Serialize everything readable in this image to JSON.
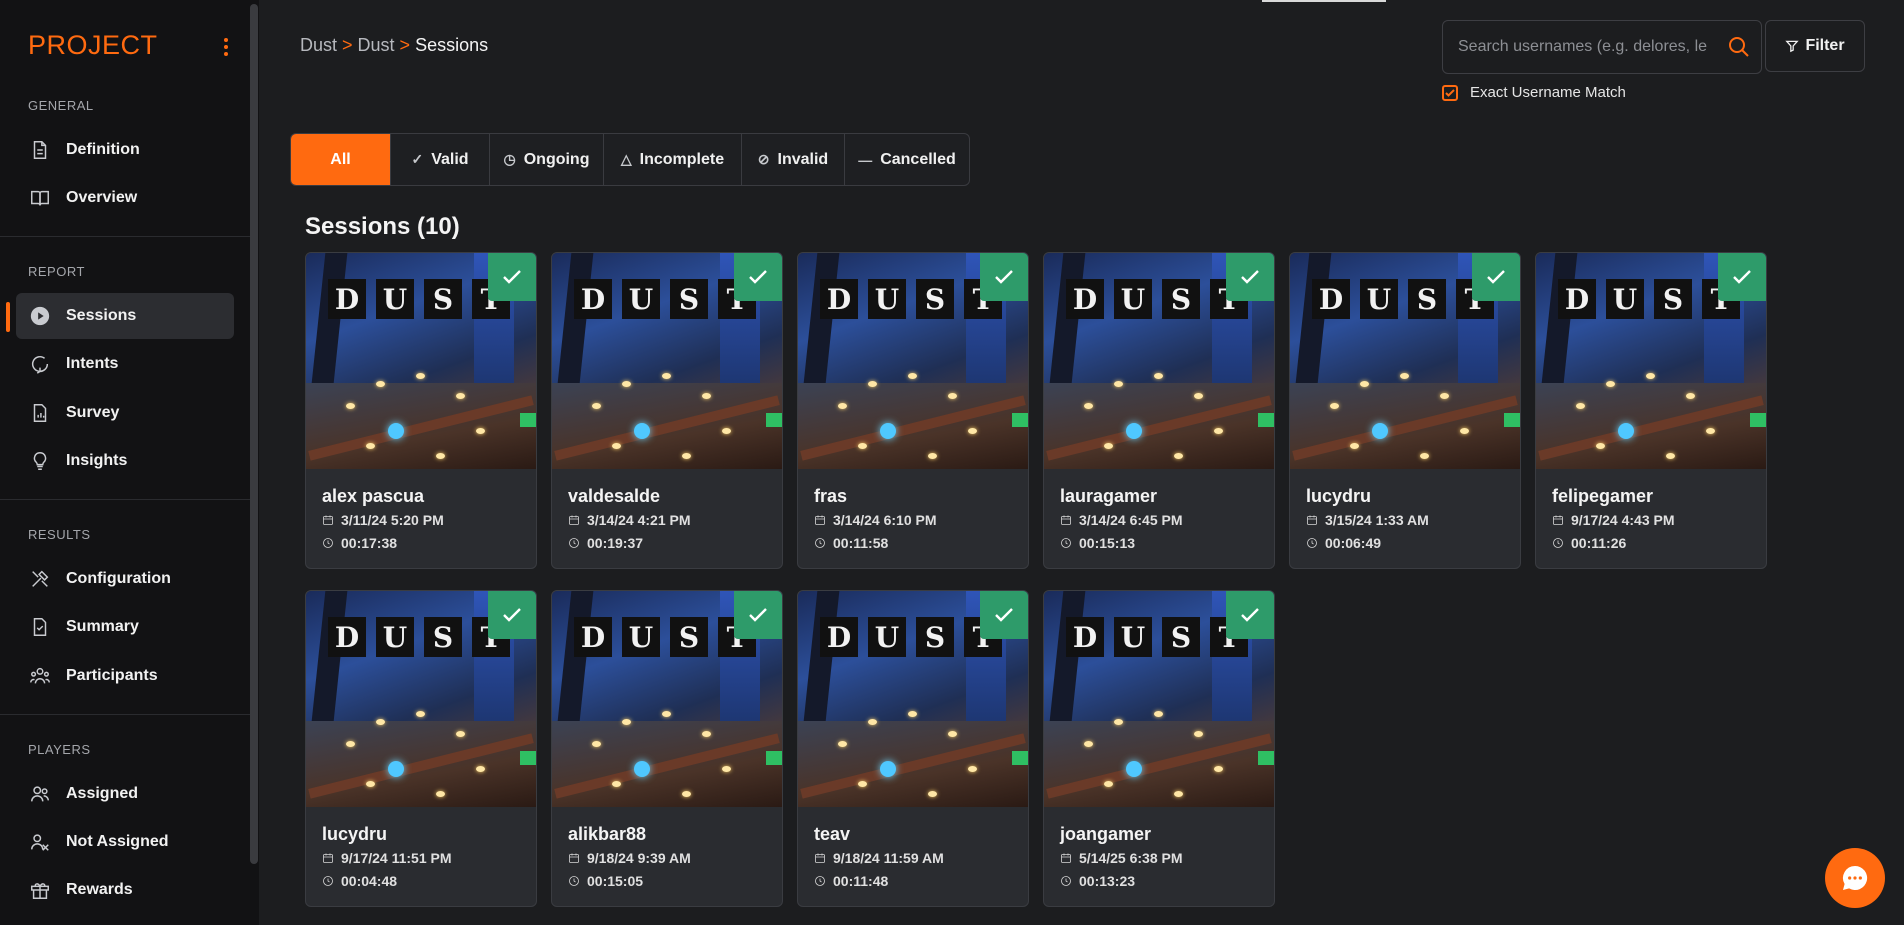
{
  "sidebar": {
    "logo": "PROJECT",
    "sections": {
      "general": "GENERAL",
      "report": "REPORT",
      "results": "RESULTS",
      "players": "PLAYERS"
    },
    "items": {
      "definition": "Definition",
      "overview": "Overview",
      "sessions": "Sessions",
      "intents": "Intents",
      "survey": "Survey",
      "insights": "Insights",
      "configuration": "Configuration",
      "summary": "Summary",
      "participants": "Participants",
      "assigned": "Assigned",
      "not_assigned": "Not Assigned",
      "rewards": "Rewards"
    }
  },
  "breadcrumb": {
    "a": "Dust",
    "sep": ">",
    "b": "Dust",
    "current": "Sessions"
  },
  "search": {
    "placeholder": "Search usernames (e.g. delores, le"
  },
  "filter": {
    "label": "Filter"
  },
  "exact_match": {
    "label": "Exact Username Match",
    "checked": true
  },
  "tabs": {
    "all": "All",
    "valid": "Valid",
    "ongoing": "Ongoing",
    "incomplete": "Incomplete",
    "invalid": "Invalid",
    "cancelled": "Cancelled"
  },
  "heading": "Sessions (10)",
  "thumb_letters": [
    "D",
    "U",
    "S",
    "T"
  ],
  "sessions": [
    {
      "name": "alex pascua",
      "date": "3/11/24 5:20 PM",
      "duration": "00:17:38"
    },
    {
      "name": "valdesalde",
      "date": "3/14/24 4:21 PM",
      "duration": "00:19:37"
    },
    {
      "name": "fras",
      "date": "3/14/24 6:10 PM",
      "duration": "00:11:58"
    },
    {
      "name": "lauragamer",
      "date": "3/14/24 6:45 PM",
      "duration": "00:15:13"
    },
    {
      "name": "lucydru",
      "date": "3/15/24 1:33 AM",
      "duration": "00:06:49"
    },
    {
      "name": "felipegamer",
      "date": "9/17/24 4:43 PM",
      "duration": "00:11:26"
    },
    {
      "name": "lucydru",
      "date": "9/17/24 11:51 PM",
      "duration": "00:04:48"
    },
    {
      "name": "alikbar88",
      "date": "9/18/24 9:39 AM",
      "duration": "00:15:05"
    },
    {
      "name": "teav",
      "date": "9/18/24 11:59 AM",
      "duration": "00:11:48"
    },
    {
      "name": "joangamer",
      "date": "5/14/25 6:38 PM",
      "duration": "00:13:23"
    }
  ],
  "colors": {
    "accent": "#ff6a10",
    "valid_badge": "#2e9b6a"
  }
}
